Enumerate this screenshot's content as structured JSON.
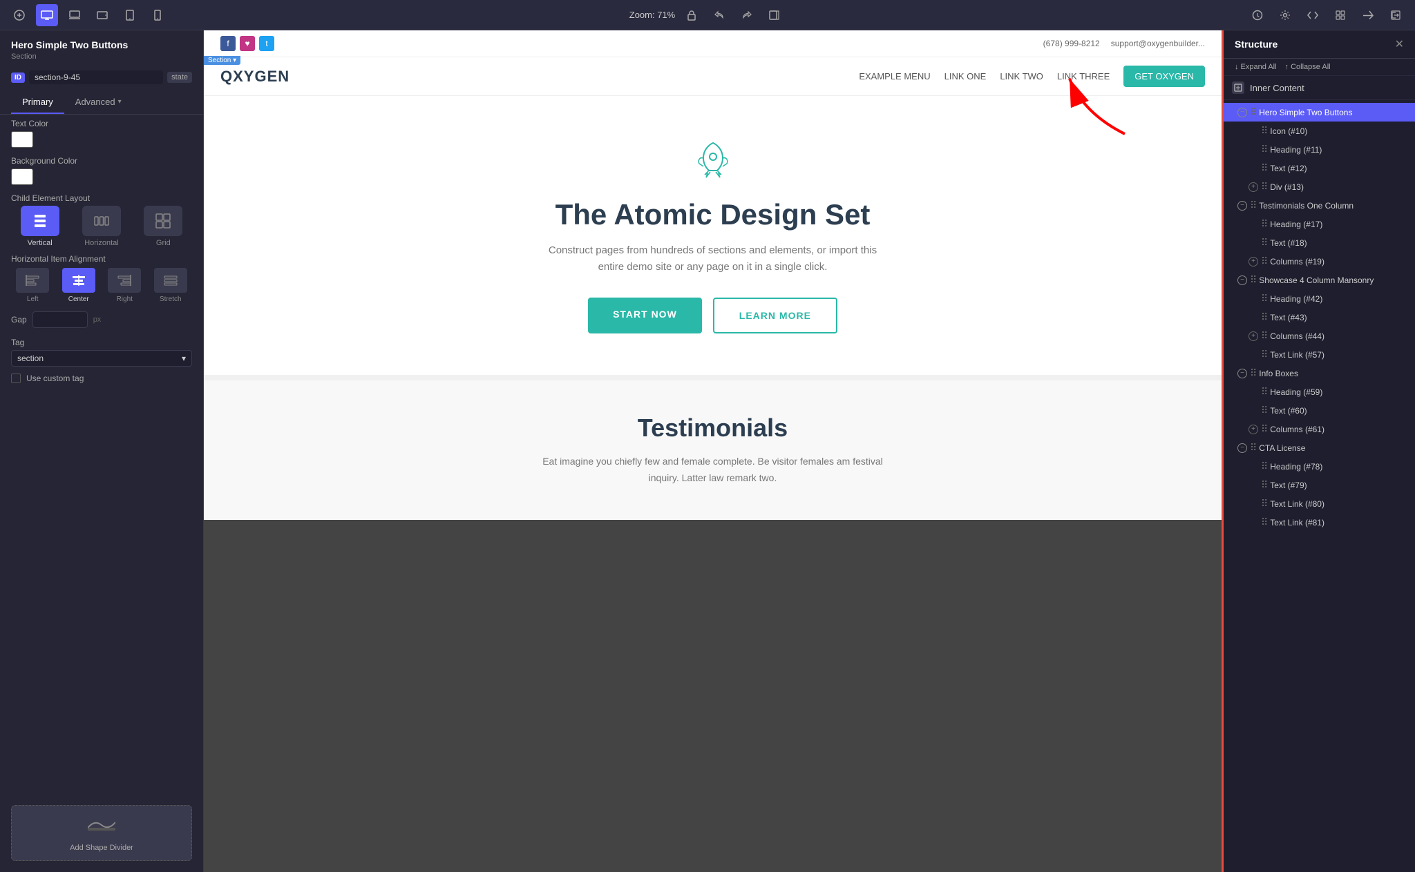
{
  "toolbar": {
    "zoom_label": "Zoom: 71%",
    "icons": [
      "add",
      "desktop",
      "laptop",
      "tablet-landscape",
      "tablet",
      "mobile"
    ],
    "active_device": "desktop"
  },
  "left_panel": {
    "title": "Hero Simple Two Buttons",
    "subtitle": "Section",
    "id_badge": "ID",
    "id_value": "section-9-45",
    "state_label": "state",
    "tabs": [
      "Primary",
      "Advanced ▾"
    ],
    "text_color_label": "Text Color",
    "bg_color_label": "Background Color",
    "child_layout_label": "Child Element Layout",
    "layout_options": [
      {
        "label": "Vertical",
        "active": true
      },
      {
        "label": "Horizontal",
        "active": false
      },
      {
        "label": "Grid",
        "active": false
      }
    ],
    "align_label": "Horizontal Item Alignment",
    "align_options": [
      {
        "label": "Left",
        "active": false
      },
      {
        "label": "Center",
        "active": true
      },
      {
        "label": "Right",
        "active": false
      },
      {
        "label": "Stretch",
        "active": false
      }
    ],
    "gap_label": "Gap",
    "gap_value": "",
    "gap_unit": "px",
    "tag_label": "Tag",
    "tag_value": "section",
    "custom_tag_label": "Use custom tag",
    "add_shape_label": "Add Shape Divider"
  },
  "canvas": {
    "social_icons": [
      "f",
      "♥",
      "t"
    ],
    "phone": "(678) 999-8212",
    "email": "support@oxygenbuilder...",
    "logo": "QXYGEN",
    "menu_items": [
      "EXAMPLE MENU",
      "LINK ONE",
      "LINK TWO",
      "LINK THREE"
    ],
    "cta_button": "GET OXYGEN",
    "section_badge": "Section",
    "hero_title": "The Atomic Design Set",
    "hero_text": "Construct pages from hundreds of sections and elements, or import this entire demo site or any page on it in a single click.",
    "btn_primary": "START NOW",
    "btn_secondary": "LEARN MORE",
    "testimonials_title": "Testimonials",
    "testimonials_text": "Eat imagine you chiefly few and female complete. Be visitor females am festival inquiry. Latter law remark two."
  },
  "right_panel": {
    "title": "Structure",
    "expand_label": "↓ Expand All",
    "collapse_label": "↑ Collapse All",
    "inner_content_label": "Inner Content",
    "tree_items": [
      {
        "level": 1,
        "toggle": "minus",
        "label": "Hero Simple Two Buttons",
        "active": true
      },
      {
        "level": 2,
        "toggle": null,
        "label": "Icon (#10)"
      },
      {
        "level": 2,
        "toggle": null,
        "label": "Heading (#11)"
      },
      {
        "level": 2,
        "toggle": null,
        "label": "Text (#12)"
      },
      {
        "level": 2,
        "toggle": "plus",
        "label": "Div (#13)"
      },
      {
        "level": 1,
        "toggle": "minus",
        "label": "Testimonials One Column"
      },
      {
        "level": 2,
        "toggle": null,
        "label": "Heading (#17)"
      },
      {
        "level": 2,
        "toggle": null,
        "label": "Text (#18)"
      },
      {
        "level": 2,
        "toggle": "plus",
        "label": "Columns (#19)"
      },
      {
        "level": 1,
        "toggle": "minus",
        "label": "Showcase 4 Column Mansonry"
      },
      {
        "level": 2,
        "toggle": null,
        "label": "Heading (#42)"
      },
      {
        "level": 2,
        "toggle": null,
        "label": "Text (#43)"
      },
      {
        "level": 2,
        "toggle": "plus",
        "label": "Columns (#44)"
      },
      {
        "level": 2,
        "toggle": null,
        "label": "Text Link (#57)"
      },
      {
        "level": 1,
        "toggle": "minus",
        "label": "Info Boxes"
      },
      {
        "level": 2,
        "toggle": null,
        "label": "Heading (#59)"
      },
      {
        "level": 2,
        "toggle": null,
        "label": "Text (#60)"
      },
      {
        "level": 2,
        "toggle": "plus",
        "label": "Columns (#61)"
      },
      {
        "level": 1,
        "toggle": "minus",
        "label": "CTA License"
      },
      {
        "level": 2,
        "toggle": null,
        "label": "Heading (#78)"
      },
      {
        "level": 2,
        "toggle": null,
        "label": "Text (#79)"
      },
      {
        "level": 2,
        "toggle": null,
        "label": "Text Link (#80)"
      },
      {
        "level": 2,
        "toggle": null,
        "label": "Text Link (#81)"
      }
    ]
  }
}
